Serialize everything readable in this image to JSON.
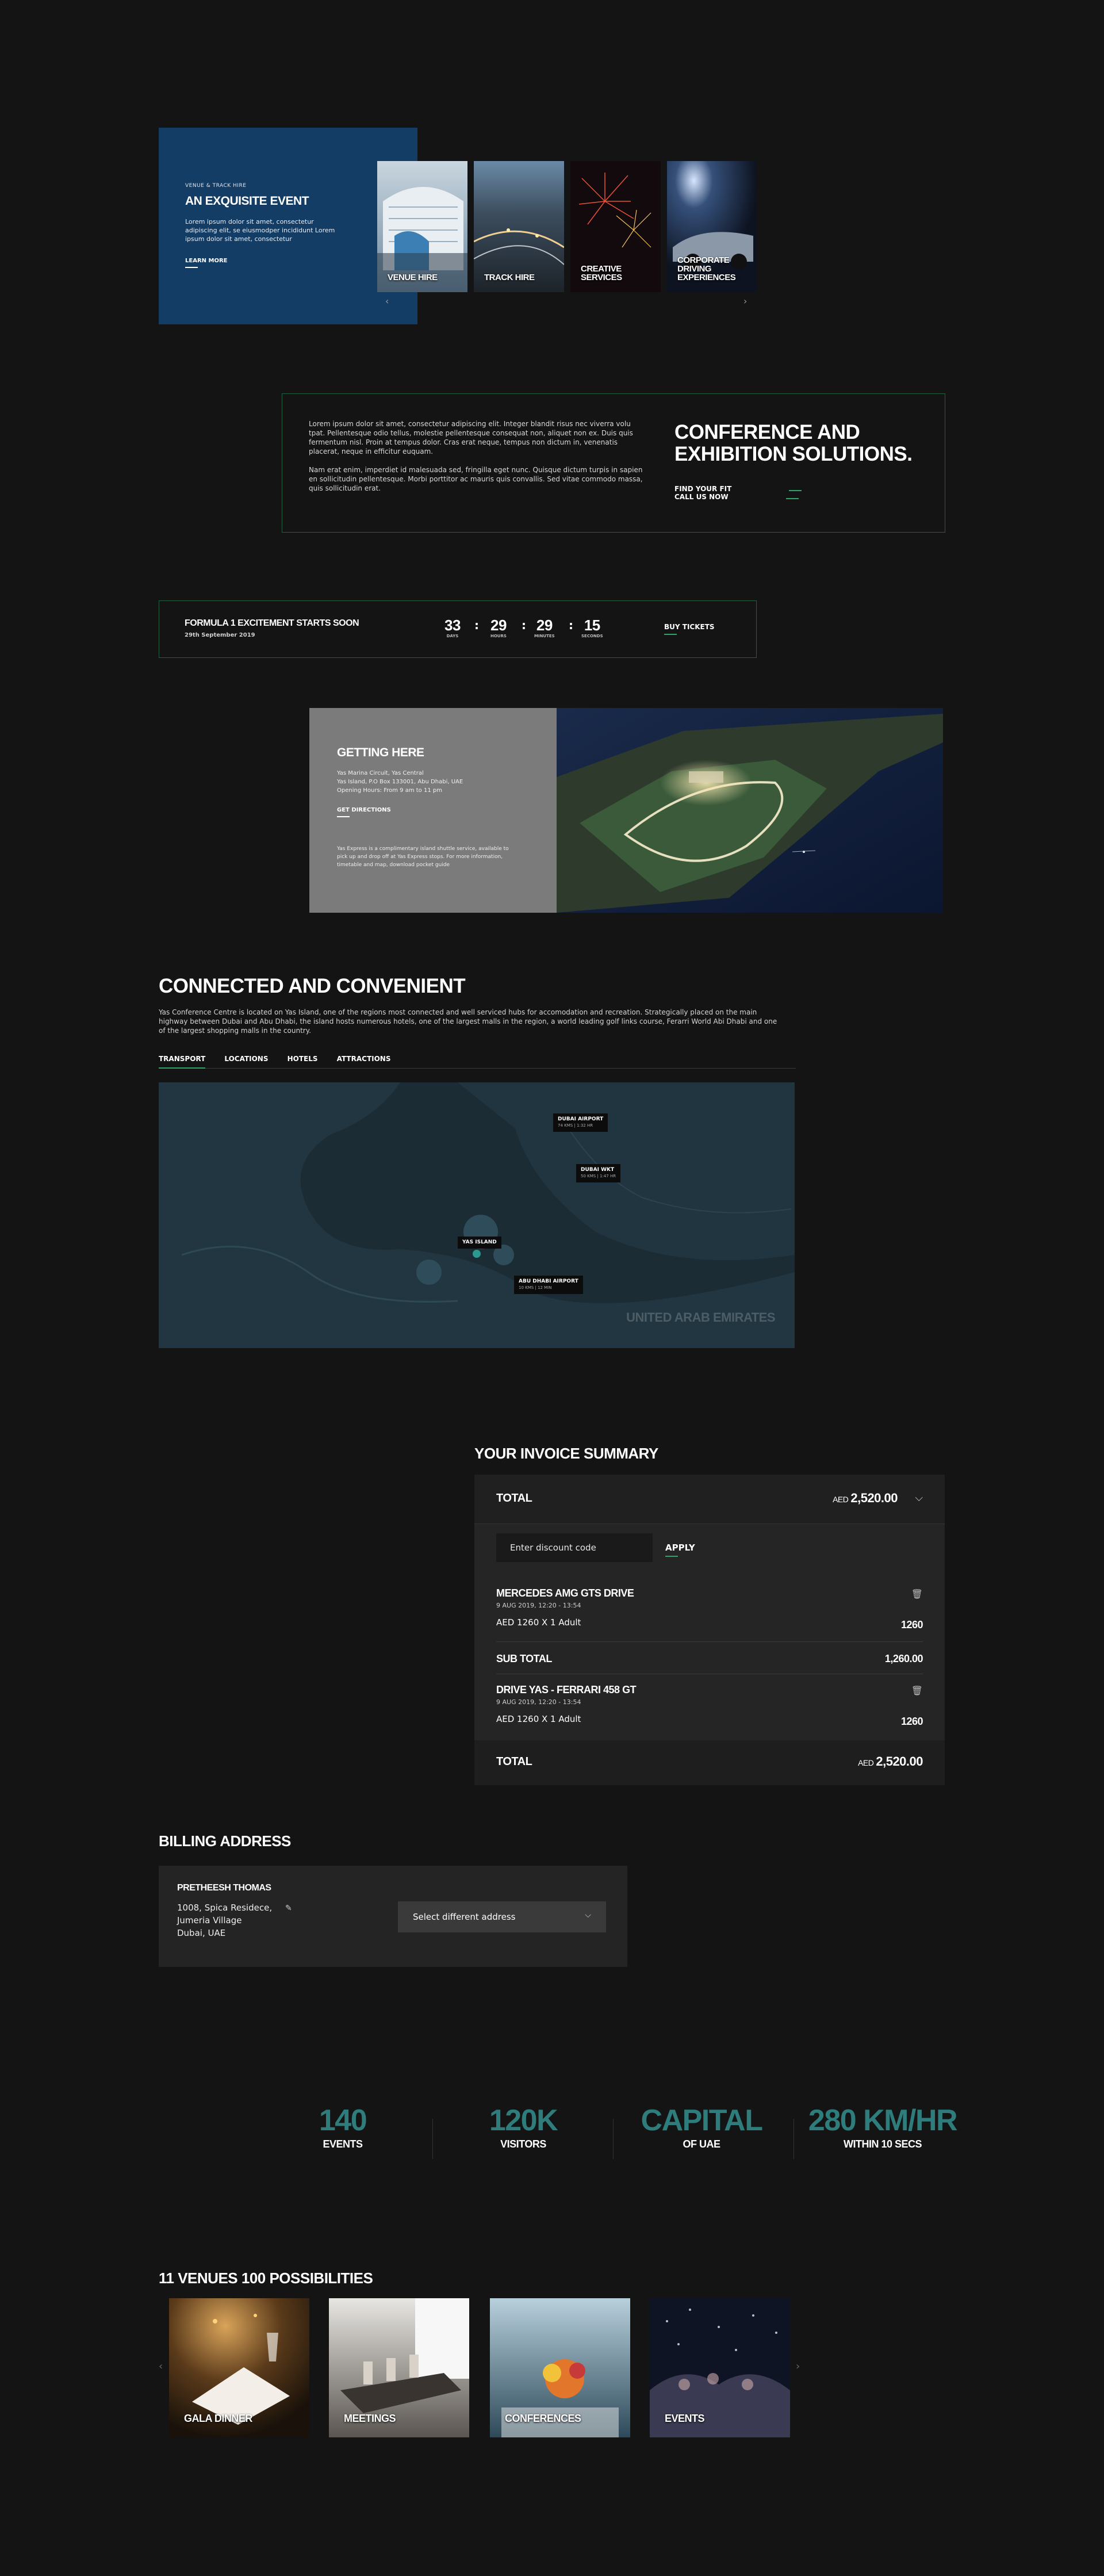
{
  "hero": {
    "kicker": "VENUE & TRACK HIRE",
    "title": "AN EXQUISITE EVENT",
    "text": "Lorem ipsum dolor sit amet, consectetur adipiscing elit, se eiusmodper incididunt Lorem ipsum dolor sit amet, consectetur",
    "link": "LEARN MORE",
    "cards": [
      {
        "label": "VENUE HIRE"
      },
      {
        "label": "TRACK HIRE"
      },
      {
        "label": "CREATIVE SERVICES"
      },
      {
        "label": "CORPORATE DRIVING EXPERIENCES"
      }
    ],
    "prev_icon": "‹",
    "next_icon": "›"
  },
  "conference": {
    "para1": "Lorem ipsum dolor sit amet, consectetur adipiscing elit. Integer blandit risus nec viverra volu tpat. Pellentesque odio tellus, molestie pellentesque consequat non, aliquet non ex. Duis quis fermentum nisl. Proin at tempus dolor. Cras erat neque, tempus non dictum in, venenatis placerat, neque in efficitur euquam.",
    "para2": "Nam erat enim, imperdiet id malesuada sed, fringilla eget nunc. Quisque dictum turpis in sapien en sollicitudin pellentesque. Morbi porttitor ac mauris quis convallis. Sed vitae commodo massa, quis sollicitudin erat.",
    "title": "CONFERENCE AND EXHIBITION SOLUTIONS.",
    "link1": "FIND YOUR FIT",
    "link2": "CALL US NOW"
  },
  "countdown": {
    "title": "FORMULA 1 EXCITEMENT STARTS SOON",
    "date": "29th September 2019",
    "days": "33",
    "days_label": "DAYS",
    "hours": "29",
    "hours_label": "HOURS",
    "minutes": "29",
    "minutes_label": "MINUTES",
    "seconds": "15",
    "seconds_label": "SECONDS",
    "sep": ":",
    "cta": "BUY TICKETS"
  },
  "getting_here": {
    "title": "GETTING HERE",
    "addr1": "Yas Marina Circuit, Yas Central",
    "addr2": "Yas Island, P.O Box 133001, Abu Dhabi, UAE",
    "addr3": "Opening Hours: From 9 am to 11 pm",
    "link": "GET DIRECTIONS",
    "note": "Yas Express is a complimentary island shuttle service, available to pick up and drop off at Yas Express stops. For more information, timetable and map, download pocket guide"
  },
  "connected": {
    "title": "CONNECTED AND CONVENIENT",
    "text": "Yas Conference Centre is located on Yas Island, one of the regions most connected and well serviced hubs for accomodation and recreation. Strategically placed on the main highway between Dubai and Abu Dhabi, the island hosts numerous hotels, one of the largest malls in the region, a world leading golf links course, Ferarri World Abi Dhabi and one of the largest shopping malls in the country.",
    "tabs": [
      "TRANSPORT",
      "LOCATIONS",
      "HOTELS",
      "ATTRACTIONS"
    ],
    "pins": [
      {
        "name": "DUBAI AIRPORT",
        "sub": "74 KMS | 1:32 HR"
      },
      {
        "name": "DUBAI WKT",
        "sub": "50 KMS | 1:47 HR"
      },
      {
        "name": "YAS ISLAND",
        "sub": ""
      },
      {
        "name": "ABU DHABI AIRPORT",
        "sub": "10 KMS | 12 MIN"
      }
    ],
    "country": "UNITED ARAB EMIRATES"
  },
  "invoice": {
    "title": "YOUR INVOICE SUMMARY",
    "total_label": "TOTAL",
    "currency": "AED",
    "total_value": "2,520.00",
    "discount_placeholder": "Enter discount code",
    "apply": "APPLY",
    "items": [
      {
        "name": "MERCEDES AMG GTS DRIVE",
        "date": "9 AUG 2019, 12:20 - 13:54",
        "price": "AED 1260  X  1 Adult",
        "amount": "1260"
      },
      {
        "name": "DRIVE YAS - FERRARI 458 GT",
        "date": "9 AUG 2019, 12:20 - 13:54",
        "price": "AED 1260  X  1 Adult",
        "amount": "1260"
      }
    ],
    "subtotal_label": "SUB TOTAL",
    "subtotal_value": "1,260.00"
  },
  "billing": {
    "title": "BILLING ADDRESS",
    "name": "PRETHEESH THOMAS",
    "line1": "1008, Spica Residece,",
    "line2": "Jumeria Village",
    "line3": "Dubai, UAE",
    "select": "Select different address"
  },
  "stats": [
    {
      "num": "140",
      "label": "EVENTS"
    },
    {
      "num": "120K",
      "label": "VISITORS"
    },
    {
      "num": "CAPITAL",
      "label": "OF UAE"
    },
    {
      "num": "280 KM/HR",
      "label": "WITHIN 10 SECS"
    }
  ],
  "venues": {
    "title": "11 VENUES 100 POSSIBILITIES",
    "cards": [
      {
        "label": "GALA DINNER"
      },
      {
        "label": "MEETINGS"
      },
      {
        "label": "CONFERENCES"
      },
      {
        "label": "EVENTS"
      }
    ],
    "prev_icon": "‹",
    "next_icon": "›"
  },
  "colors": {
    "accent": "#2fa56a",
    "panel_blue": "#143d66",
    "stat_teal": "#2e7c7c"
  }
}
